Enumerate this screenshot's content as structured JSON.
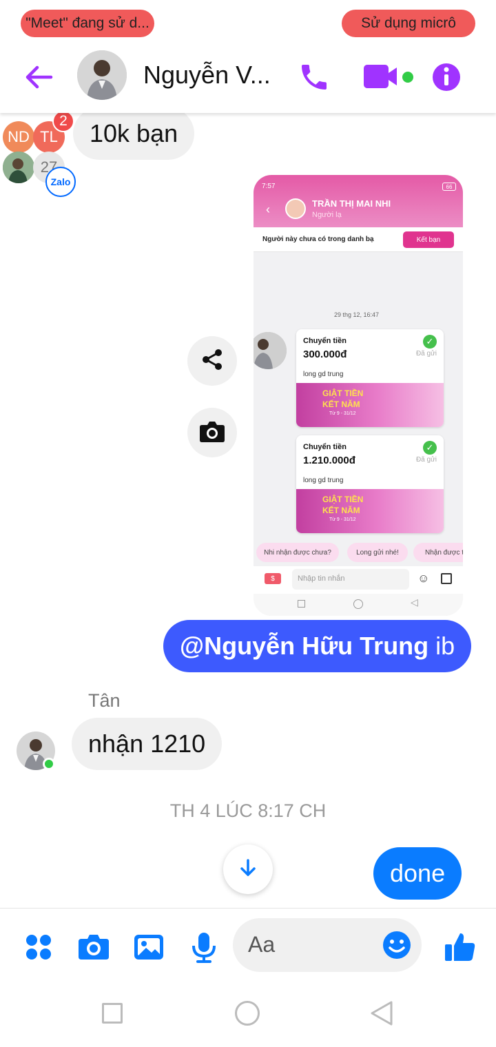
{
  "status": {
    "left_pill": "\"Meet\" đang sử d...",
    "right_pill": "Sử dụng micrô"
  },
  "header": {
    "contact_name": "Nguyễn V...",
    "back_icon": "arrow-left-icon",
    "call_icon": "phone-icon",
    "video_icon": "video-camera-icon",
    "info_icon": "info-icon"
  },
  "accent_color": "#a033ff",
  "messages": {
    "incoming_top": "10k bạn",
    "group_avatars": {
      "a": "ND",
      "b": "TL",
      "count": "27",
      "badge": "2",
      "app": "Zalo"
    },
    "mention": "@Nguyễn Hữu Trung",
    "mention_suffix": " ib",
    "sender_name": "Tân",
    "incoming_reply": "nhận 1210",
    "timestamp": "TH 4 LÚC 8:17 CH",
    "outgoing_done": "done"
  },
  "shared_screenshot": {
    "status_time": "7:57",
    "battery": "66",
    "contact_name": "TRẦN THỊ MAI NHI",
    "contact_sub": "Người lạ",
    "notice": "Người này chưa có trong danh bạ",
    "add_friend": "Kết bạn",
    "date_divider": "29 thg 12, 16:47",
    "cards": [
      {
        "title": "Chuyển tiền",
        "amount": "300.000đ",
        "status": "Đã gửi",
        "memo": "long gd trung",
        "banner_line1": "GIẬT TIỀN",
        "banner_line2": "KẾT NĂM",
        "banner_dates": "Từ 9 - 31/12"
      },
      {
        "title": "Chuyển tiền",
        "amount": "1.210.000đ",
        "status": "Đã gửi",
        "memo": "long gd trung",
        "banner_line1": "GIẬT TIỀN",
        "banner_line2": "KẾT NĂM",
        "banner_dates": "Từ 9 - 31/12"
      }
    ],
    "quick_replies": [
      "Nhi nhận được chưa?",
      "Long gửi nhé!",
      "Nhận được t"
    ],
    "input_placeholder": "Nhập tin nhắn"
  },
  "composer": {
    "placeholder": "Aa",
    "menu_icon": "apps-icon",
    "camera_icon": "camera-icon",
    "gallery_icon": "image-icon",
    "mic_icon": "microphone-icon",
    "emoji_icon": "emoji-icon",
    "like_icon": "thumbs-up-icon"
  },
  "colors": {
    "messenger_blue": "#0a7cff",
    "mention_bubble": "#3d5afe",
    "pill_red": "#f05a5a"
  }
}
